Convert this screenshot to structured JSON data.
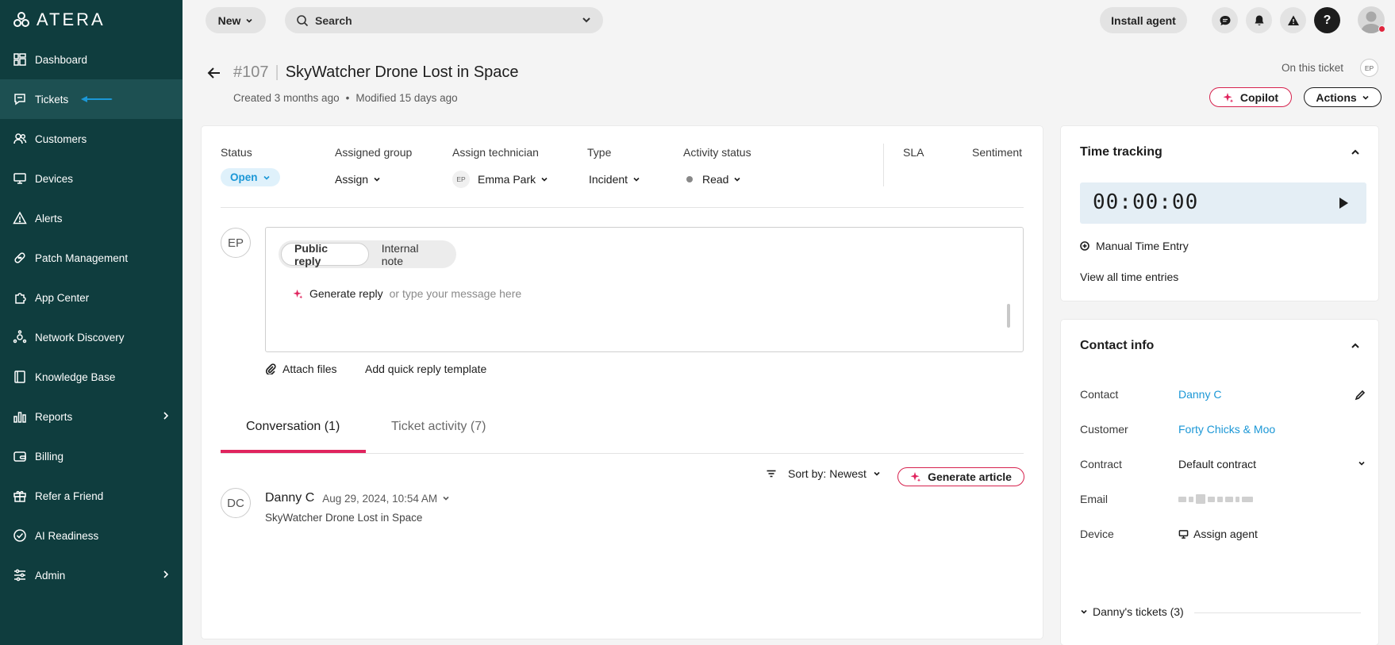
{
  "brand": {
    "name": "ATERA"
  },
  "sidebar": {
    "items": [
      {
        "label": "Dashboard",
        "icon": "dashboard-icon"
      },
      {
        "label": "Tickets",
        "icon": "tickets-icon",
        "active": true
      },
      {
        "label": "Customers",
        "icon": "customers-icon"
      },
      {
        "label": "Devices",
        "icon": "devices-icon"
      },
      {
        "label": "Alerts",
        "icon": "alerts-icon"
      },
      {
        "label": "Patch Management",
        "icon": "patch-icon"
      },
      {
        "label": "App Center",
        "icon": "app-center-icon"
      },
      {
        "label": "Network Discovery",
        "icon": "network-icon"
      },
      {
        "label": "Knowledge Base",
        "icon": "knowledge-icon"
      },
      {
        "label": "Reports",
        "icon": "reports-icon",
        "expandable": true
      },
      {
        "label": "Billing",
        "icon": "billing-icon"
      },
      {
        "label": "Refer a Friend",
        "icon": "gift-icon"
      },
      {
        "label": "AI Readiness",
        "icon": "ai-readiness-icon"
      },
      {
        "label": "Admin",
        "icon": "admin-icon",
        "expandable": true
      }
    ]
  },
  "topbar": {
    "new_label": "New",
    "search_label": "Search",
    "install_label": "Install agent",
    "help_label": "?"
  },
  "ticket": {
    "number": "#107",
    "title": "SkyWatcher Drone Lost in Space",
    "created": "Created 3 months ago",
    "modified": "Modified 15 days ago",
    "on_this_ticket": "On this ticket",
    "viewer_initials": "EP",
    "copilot_label": "Copilot",
    "actions_label": "Actions"
  },
  "fields": {
    "status_label": "Status",
    "status_value": "Open",
    "group_label": "Assigned group",
    "group_value": "Assign",
    "tech_label": "Assign technician",
    "tech_initials": "EP",
    "tech_value": "Emma Park",
    "type_label": "Type",
    "type_value": "Incident",
    "activity_label": "Activity status",
    "activity_value": "Read",
    "sla_label": "SLA",
    "sentiment_label": "Sentiment"
  },
  "reply": {
    "author_initials": "EP",
    "tab_public": "Public reply",
    "tab_internal": "Internal note",
    "generate_label": "Generate reply",
    "placeholder": "or type your message here",
    "attach_label": "Attach files",
    "quick_reply_label": "Add quick reply template"
  },
  "conversation": {
    "tab_conversation": "Conversation (1)",
    "tab_activity": "Ticket activity (7)",
    "sort_label": "Sort by:",
    "sort_value": "Newest",
    "generate_article_label": "Generate article",
    "messages": [
      {
        "initials": "DC",
        "author": "Danny C",
        "date": "Aug 29, 2024, 10:54 AM",
        "subject": "SkyWatcher Drone Lost in Space"
      }
    ]
  },
  "time_tracking": {
    "title": "Time tracking",
    "timer": "00:00:00",
    "manual_label": "Manual Time Entry",
    "view_all_label": "View all time entries"
  },
  "contact_info": {
    "title": "Contact info",
    "contact_label": "Contact",
    "contact_value": "Danny C",
    "customer_label": "Customer",
    "customer_value": "Forty Chicks & Moo",
    "contract_label": "Contract",
    "contract_value": "Default contract",
    "email_label": "Email",
    "device_label": "Device",
    "device_value": "Assign agent",
    "tickets_label": "Danny's tickets (3)"
  },
  "colors": {
    "sidebar_bg": "#0f3d3e",
    "accent_pink": "#e0245e",
    "link_blue": "#1b97d6",
    "status_bg": "#dff1fb"
  }
}
